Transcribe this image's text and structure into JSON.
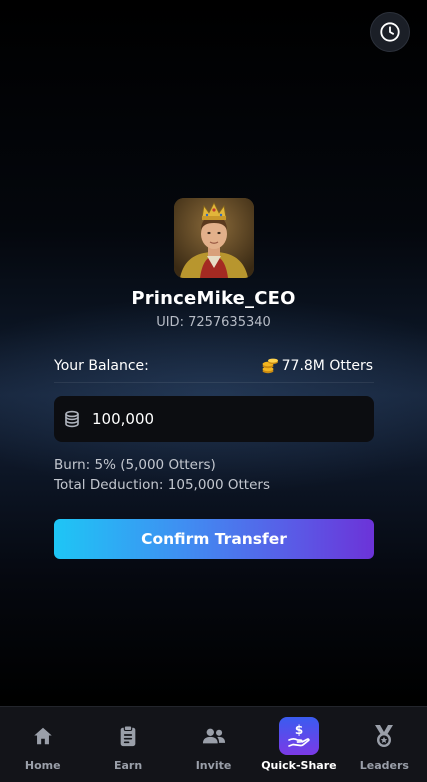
{
  "profile": {
    "username": "PrinceMike_CEO",
    "uid": "UID: 7257635340"
  },
  "balance": {
    "label": "Your Balance:",
    "value": "77.8M Otters"
  },
  "transfer": {
    "amount_value": "100,000",
    "burn_text": "Burn: 5% (5,000 Otters)",
    "total_deduction_text": "Total Deduction: 105,000 Otters",
    "confirm_label": "Confirm Transfer"
  },
  "nav": {
    "items": [
      {
        "label": "Home",
        "icon": "home-icon"
      },
      {
        "label": "Earn",
        "icon": "clipboard-icon"
      },
      {
        "label": "Invite",
        "icon": "users-icon"
      },
      {
        "label": "Quick-Share",
        "icon": "hand-dollar-icon",
        "active": true
      },
      {
        "label": "Leaders",
        "icon": "medal-icon"
      }
    ]
  },
  "colors": {
    "accent_gradient_start": "#1ec6f5",
    "accent_gradient_end": "#6c33d8",
    "coin_gold": "#f2b51f"
  }
}
